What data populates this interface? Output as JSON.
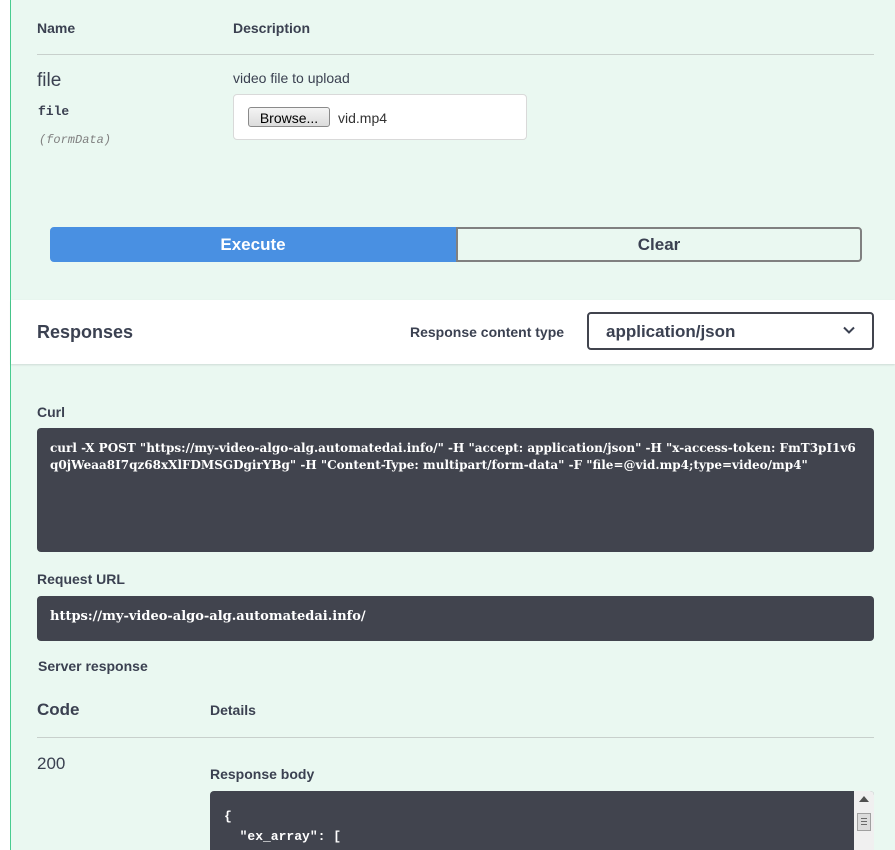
{
  "parameters": {
    "headers": {
      "name": "Name",
      "description": "Description"
    },
    "param": {
      "name": "file",
      "type": "file",
      "in": "(formData)",
      "description": "video file to upload",
      "browse_label": "Browse...",
      "file_name": "vid.mp4"
    }
  },
  "actions": {
    "execute": "Execute",
    "clear": "Clear"
  },
  "responses": {
    "title": "Responses",
    "content_type_label": "Response content type",
    "content_type_value": "application/json"
  },
  "curl": {
    "label": "Curl",
    "command": "curl -X POST \"https://my-video-algo-alg.automatedai.info/\" -H \"accept: application/json\" -H \"x-access-token: FmT3pI1v6q0jWeaa8I7qz68xXlFDMSGDgirYBg\" -H \"Content-Type: multipart/form-data\" -F \"file=@vid.mp4;type=video/mp4\""
  },
  "request_url": {
    "label": "Request URL",
    "url": "https://my-video-algo-alg.automatedai.info/"
  },
  "server_response": {
    "label": "Server response",
    "code_header": "Code",
    "details_header": "Details",
    "code": "200",
    "body_label": "Response body",
    "body": "{\n  \"ex_array\": ["
  },
  "colors": {
    "panel_bg": "#eaf8f1",
    "panel_border": "#49cc90",
    "execute": "#4990e2",
    "code_bg": "#41444e"
  }
}
